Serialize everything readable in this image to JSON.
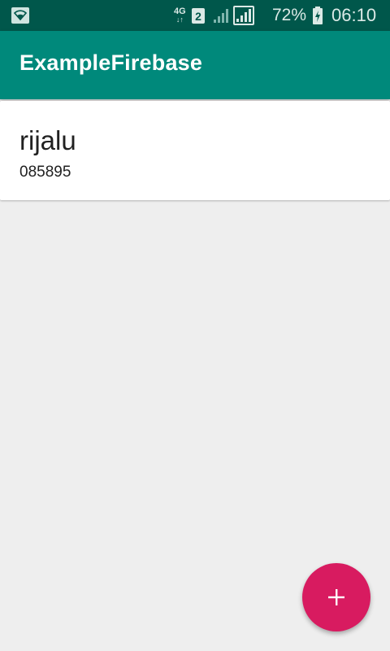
{
  "status_bar": {
    "network_type": "4G",
    "network_arrows": "↓↑",
    "sim_slot": "2",
    "battery_percent": "72%",
    "time": "06:10"
  },
  "app_bar": {
    "title": "ExampleFirebase"
  },
  "contacts": [
    {
      "name": "rijalu",
      "phone": "085895"
    }
  ],
  "fab": {
    "icon": "plus-icon"
  },
  "colors": {
    "status_bar": "#00574b",
    "app_bar": "#00897b",
    "accent": "#d81b60",
    "background": "#eeeeee"
  }
}
